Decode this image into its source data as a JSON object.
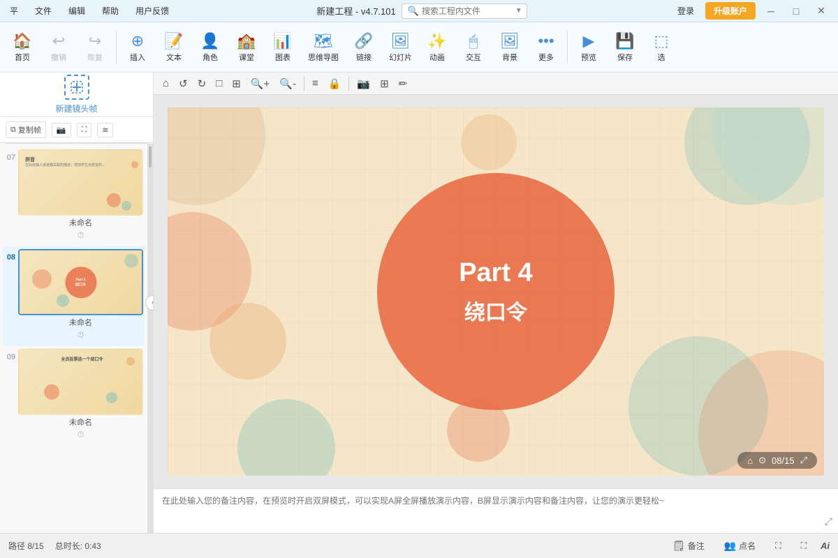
{
  "titlebar": {
    "menus": [
      "平",
      "文件",
      "编辑",
      "帮助",
      "用户反馈"
    ],
    "title": "新建工程 - v4.7.101",
    "search_placeholder": "搜索工程内文件",
    "login_label": "登录",
    "upgrade_label": "升级账户",
    "win_buttons": [
      "─",
      "□",
      "✕"
    ]
  },
  "toolbar": {
    "home": "首页",
    "undo": "撤销",
    "redo": "恢复",
    "insert": "插入",
    "text": "文本",
    "role": "角色",
    "classroom": "课堂",
    "chart": "图表",
    "mindmap": "思维导图",
    "link": "链接",
    "slideshow": "幻灯片",
    "animation": "动画",
    "interact": "交互",
    "background": "背景",
    "more": "更多",
    "preview": "预览",
    "save": "保存",
    "select": "选"
  },
  "sidebar": {
    "new_frame_label": "新建镜头帧",
    "copy_btn": "复制帧",
    "slides": [
      {
        "num": "07",
        "name": "未命名",
        "active": false,
        "has_icon": true
      },
      {
        "num": "08",
        "name": "未命名",
        "active": true,
        "has_icon": true
      },
      {
        "num": "09",
        "name": "未命名",
        "active": false,
        "has_icon": true
      }
    ]
  },
  "canvas": {
    "slide_num": "08",
    "total_slides": "15",
    "counter_text": "08/15",
    "main_text": "Part 4",
    "subtitle": "绕口令"
  },
  "notes": {
    "placeholder": "在此处输入您的备注内容，在预览时开启双屏模式，可以实现A屏全屏播放演示内容，B屏显示演示内容和备注内容，让您的演示更轻松~"
  },
  "statusbar": {
    "path": "路径 8/15",
    "duration": "总时长: 0:43",
    "notes_btn": "备注",
    "callname_btn": "点名",
    "ai_label": "Ai"
  }
}
